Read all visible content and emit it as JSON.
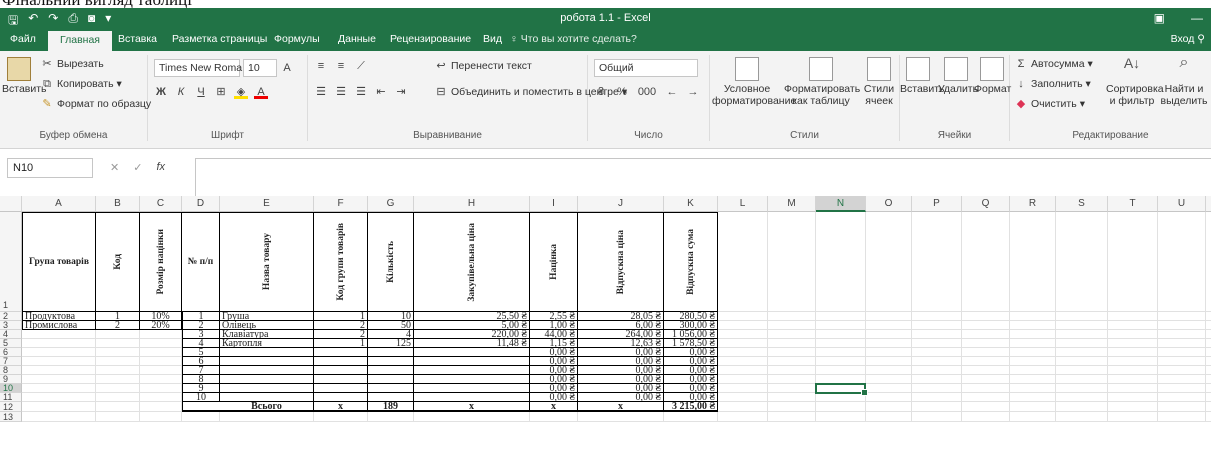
{
  "caption": "Фінальний вигляд таблиці",
  "window": {
    "title": "робота 1.1 - Excel"
  },
  "tabs": [
    "Файл",
    "Главная",
    "Вставка",
    "Разметка страницы",
    "Формулы",
    "Данные",
    "Рецензирование",
    "Вид"
  ],
  "active_tab": "Главная",
  "tellme": "Что вы хотите сделать?",
  "signin": "Вход",
  "ribbon": {
    "clipboard": {
      "paste": "Вставить",
      "cut": "Вырезать",
      "copy": "Копировать",
      "format_painter": "Формат по образцу",
      "label": "Буфер обмена"
    },
    "font": {
      "name": "Times New Roma",
      "size": "10",
      "label": "Шрифт"
    },
    "alignment": {
      "wrap": "Перенести текст",
      "merge": "Объединить и поместить в центре",
      "label": "Выравнивание"
    },
    "number": {
      "format": "Общий",
      "label": "Число"
    },
    "styles": {
      "conditional": "Условное форматирование",
      "as_table": "Форматировать как таблицу",
      "cell_styles": "Стили ячеек",
      "label": "Стили"
    },
    "cells": {
      "insert": "Вставить",
      "delete": "Удалить",
      "format": "Формат",
      "label": "Ячейки"
    },
    "editing": {
      "autosum": "Автосумма",
      "fill": "Заполнить",
      "clear": "Очистить",
      "sort": "Сортировка и фильтр",
      "find": "Найти и выделить",
      "label": "Редактирование"
    }
  },
  "namebox": "N10",
  "columns": [
    "A",
    "B",
    "C",
    "D",
    "E",
    "F",
    "G",
    "H",
    "I",
    "J",
    "K",
    "L",
    "M",
    "N",
    "O",
    "P",
    "Q",
    "R",
    "S",
    "T",
    "U",
    "V"
  ],
  "selected_col": "N",
  "selected_row": "10",
  "headers": {
    "group": "Група товарів",
    "code": "Код",
    "markup_size": "Розмір націнки",
    "no": "№ п/п",
    "name": "Назва товару",
    "group_code": "Код групи товарів",
    "qty": "Кількість",
    "purchase": "Закупівельна ціна",
    "markup": "Націнка",
    "sale_price": "Відпускна ціна",
    "sale_sum": "Відпускна сума"
  },
  "groups": [
    {
      "name": "Продуктова",
      "code": "1",
      "pct": "10%"
    },
    {
      "name": "Промислова",
      "code": "2",
      "pct": "20%"
    }
  ],
  "items": [
    {
      "n": "1",
      "name": "Груша",
      "g": "1",
      "q": "10",
      "p": "25,50 ₴",
      "m": "2,55 ₴",
      "sp": "28,05 ₴",
      "ss": "280,50 ₴"
    },
    {
      "n": "2",
      "name": "Олівець",
      "g": "2",
      "q": "50",
      "p": "5,00 ₴",
      "m": "1,00 ₴",
      "sp": "6,00 ₴",
      "ss": "300,00 ₴"
    },
    {
      "n": "3",
      "name": "Клавіатура",
      "g": "2",
      "q": "4",
      "p": "220,00 ₴",
      "m": "44,00 ₴",
      "sp": "264,00 ₴",
      "ss": "1 056,00 ₴"
    },
    {
      "n": "4",
      "name": "Картопля",
      "g": "1",
      "q": "125",
      "p": "11,48 ₴",
      "m": "1,15 ₴",
      "sp": "12,63 ₴",
      "ss": "1 578,50 ₴"
    },
    {
      "n": "5",
      "name": "",
      "g": "",
      "q": "",
      "p": "",
      "m": "0,00 ₴",
      "sp": "0,00 ₴",
      "ss": "0,00 ₴"
    },
    {
      "n": "6",
      "name": "",
      "g": "",
      "q": "",
      "p": "",
      "m": "0,00 ₴",
      "sp": "0,00 ₴",
      "ss": "0,00 ₴"
    },
    {
      "n": "7",
      "name": "",
      "g": "",
      "q": "",
      "p": "",
      "m": "0,00 ₴",
      "sp": "0,00 ₴",
      "ss": "0,00 ₴"
    },
    {
      "n": "8",
      "name": "",
      "g": "",
      "q": "",
      "p": "",
      "m": "0,00 ₴",
      "sp": "0,00 ₴",
      "ss": "0,00 ₴"
    },
    {
      "n": "9",
      "name": "",
      "g": "",
      "q": "",
      "p": "",
      "m": "0,00 ₴",
      "sp": "0,00 ₴",
      "ss": "0,00 ₴"
    },
    {
      "n": "10",
      "name": "",
      "g": "",
      "q": "",
      "p": "",
      "m": "0,00 ₴",
      "sp": "0,00 ₴",
      "ss": "0,00 ₴"
    }
  ],
  "total": {
    "label": "Всього",
    "g": "x",
    "q": "189",
    "p": "x",
    "m": "x",
    "sp": "x",
    "ss": "3 215,00 ₴"
  },
  "rows": [
    "1",
    "2",
    "3",
    "4",
    "5",
    "6",
    "7",
    "8",
    "9",
    "10",
    "11",
    "12",
    "13"
  ]
}
